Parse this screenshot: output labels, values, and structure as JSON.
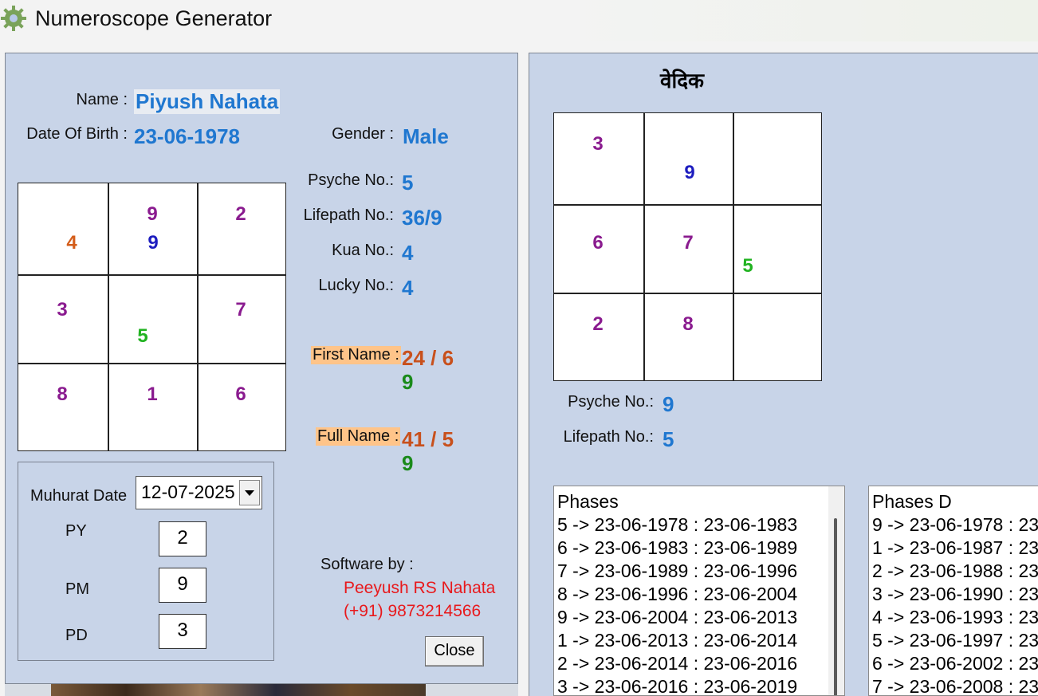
{
  "window": {
    "title": "Numeroscope Generator",
    "icon": "gear-flower-icon"
  },
  "left_panel": {
    "name_label": "Name :",
    "name_value": "Piyush Nahata",
    "dob_label": "Date Of Birth :",
    "dob_value": "23-06-1978",
    "gender_label": "Gender :",
    "gender_value": "Male",
    "psyche_label": "Psyche No.:",
    "psyche_value": "5",
    "lifepath_label": "Lifepath No.:",
    "lifepath_value": "36/9",
    "kua_label": "Kua No.:",
    "kua_value": "4",
    "lucky_label": "Lucky No.:",
    "lucky_value": "4",
    "first_name_label": "First Name :",
    "first_name_value": "24 / 6",
    "first_name_sub": "9",
    "full_name_label": "Full Name :",
    "full_name_value": "41 / 5",
    "full_name_sub": "9",
    "grid": {
      "top_left": [
        "4"
      ],
      "top_mid": [
        "9",
        "9"
      ],
      "top_right": [
        "2"
      ],
      "mid_left": [
        "3"
      ],
      "mid_mid": [
        "5"
      ],
      "mid_right": [
        "7"
      ],
      "bot_left": [
        "8"
      ],
      "bot_mid": [
        "1"
      ],
      "bot_right": [
        "6"
      ]
    },
    "muhurat": {
      "label": "Muhurat Date",
      "date": "12-07-2025",
      "py_label": "PY",
      "py_value": "2",
      "pm_label": "PM",
      "pm_value": "9",
      "pd_label": "PD",
      "pd_value": "3"
    },
    "software_by_label": "Software by :",
    "author": "Peeyush RS Nahata",
    "phone": "(+91) 9873214566",
    "close_label": "Close"
  },
  "right_panel": {
    "heading": "वेदिक",
    "grid": {
      "top_left": [
        "3"
      ],
      "top_mid": [
        "9"
      ],
      "mid_left": [
        "6"
      ],
      "mid_mid": [
        "7"
      ],
      "mid_right": [
        "5"
      ],
      "bot_left": [
        "2"
      ],
      "bot_mid": [
        "8"
      ]
    },
    "psyche_label": "Psyche No.:",
    "psyche_value": "9",
    "lifepath_label": "Lifepath No.:",
    "lifepath_value": "5",
    "phases": {
      "header": "Phases",
      "rows": [
        "5 -> 23-06-1978 : 23-06-1983",
        "6 -> 23-06-1983 : 23-06-1989",
        "7 -> 23-06-1989 : 23-06-1996",
        "8 -> 23-06-1996 : 23-06-2004",
        "9 -> 23-06-2004 : 23-06-2013",
        "1 -> 23-06-2013 : 23-06-2014",
        "2 -> 23-06-2014 : 23-06-2016",
        "3 -> 23-06-2016 : 23-06-2019"
      ]
    },
    "phases_d": {
      "header": "Phases D",
      "rows": [
        "9 -> 23-06-1978 : 23",
        "1 -> 23-06-1987 : 23",
        "2 -> 23-06-1988 : 23",
        "3 -> 23-06-1990 : 23",
        "4 -> 23-06-1993 : 23",
        "5 -> 23-06-1997 : 23",
        "6 -> 23-06-2002 : 23",
        "7 -> 23-06-2008 : 23"
      ]
    }
  }
}
